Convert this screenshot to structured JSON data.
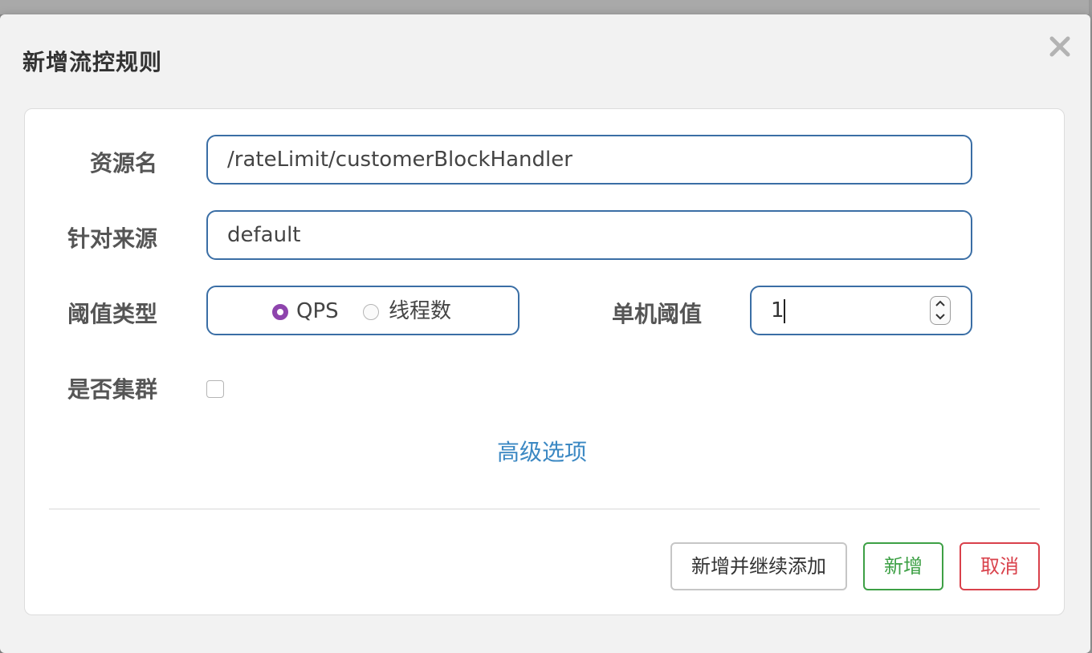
{
  "dialog": {
    "title": "新增流控规则",
    "close_icon": "close-icon"
  },
  "form": {
    "resource_label": "资源名",
    "resource_value": "/rateLimit/customerBlockHandler",
    "source_label": "针对来源",
    "source_value": "default",
    "threshold_type_label": "阈值类型",
    "threshold_type_options": [
      {
        "label": "QPS",
        "checked": true
      },
      {
        "label": "线程数",
        "checked": false
      }
    ],
    "single_threshold_label": "单机阈值",
    "single_threshold_value": "1",
    "cluster_label": "是否集群",
    "cluster_checked": false,
    "advanced_link": "高级选项"
  },
  "footer": {
    "add_continue_label": "新增并继续添加",
    "add_label": "新增",
    "cancel_label": "取消"
  },
  "colors": {
    "accent": "#3a6ea5",
    "radio_checked": "#8e44ad",
    "link": "#3b88c3",
    "success": "#3da045",
    "danger": "#d9414b"
  }
}
